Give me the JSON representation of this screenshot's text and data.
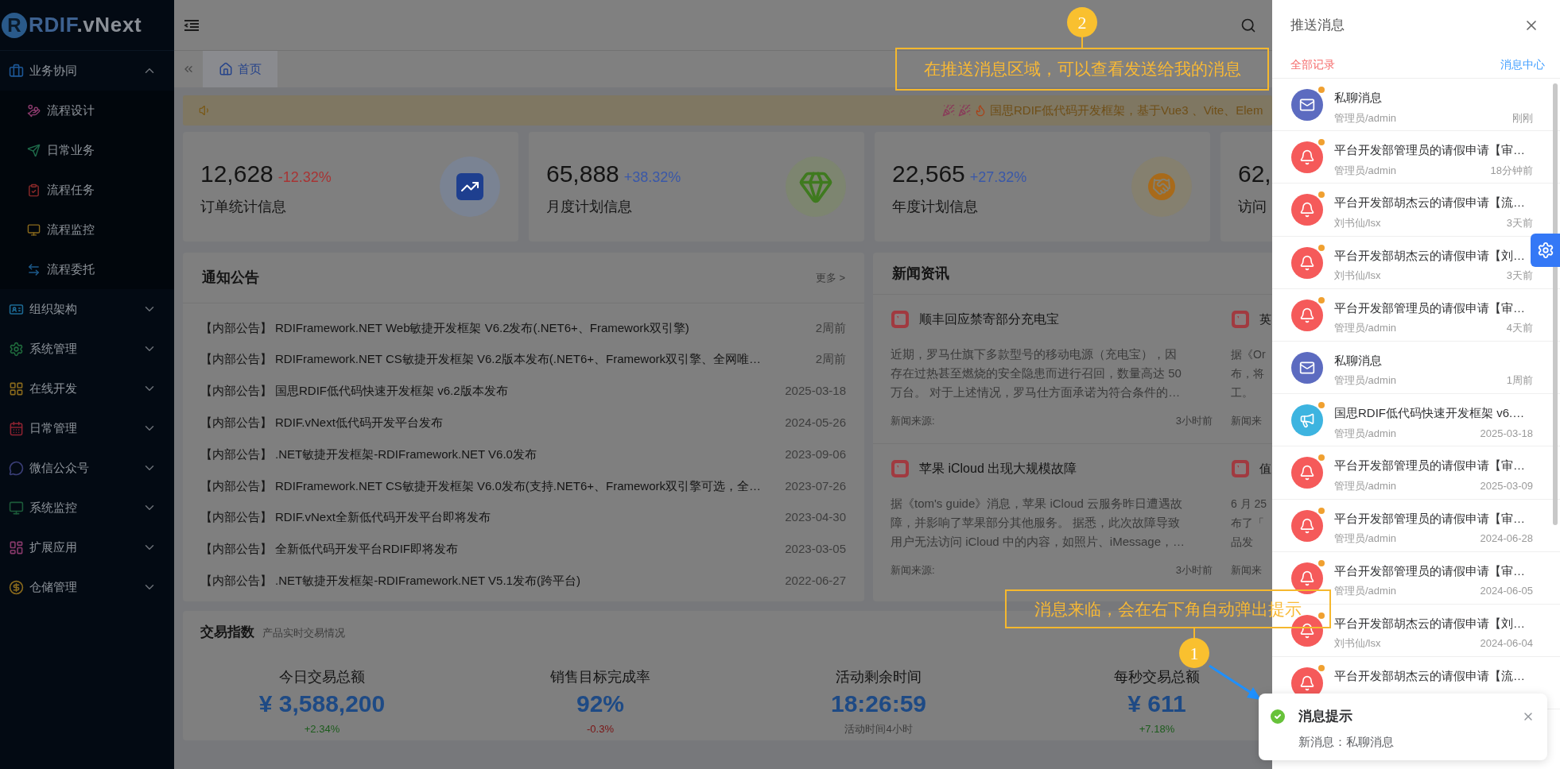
{
  "logo": {
    "mark": "R",
    "name": "RDIF",
    "suffix": ".vNext"
  },
  "sidebar": {
    "items": [
      {
        "label": "业务协同",
        "expanded": true,
        "children": [
          {
            "label": "流程设计"
          },
          {
            "label": "日常业务"
          },
          {
            "label": "流程任务"
          },
          {
            "label": "流程监控"
          },
          {
            "label": "流程委托"
          }
        ]
      },
      {
        "label": "组织架构",
        "expanded": false
      },
      {
        "label": "系统管理",
        "expanded": false
      },
      {
        "label": "在线开发",
        "expanded": false
      },
      {
        "label": "日常管理",
        "expanded": false
      },
      {
        "label": "微信公众号",
        "expanded": false
      },
      {
        "label": "系统监控",
        "expanded": false
      },
      {
        "label": "扩展应用",
        "expanded": false
      },
      {
        "label": "仓储管理",
        "expanded": false
      }
    ]
  },
  "tabs": [
    {
      "label": "首页",
      "selected": true
    }
  ],
  "announcement": {
    "text": "国思RDIF低代码开发框架，基于Vue3 、Vite、Elem"
  },
  "stats": [
    {
      "value": "12,628",
      "change": "-12.32%",
      "color": "#a83434",
      "label": "订单统计信息"
    },
    {
      "value": "65,888",
      "change": "+38.32%",
      "color": "#3a58a8",
      "label": "月度计划信息"
    },
    {
      "value": "22,565",
      "change": "+27.32%",
      "color": "#3a58a8",
      "label": "年度计划信息"
    },
    {
      "value": "62,",
      "label": "访问"
    }
  ],
  "notices": {
    "title": "通知公告",
    "more": "更多 >",
    "rows": [
      {
        "tag": "【内部公告】",
        "title": "RDIFramework.NET Web敏捷开发框架 V6.2发布(.NET6+、Framework双引擎)",
        "time": "2周前"
      },
      {
        "tag": "【内部公告】",
        "title": "RDIFramework.NET CS敏捷开发框架 V6.2版本发布(.NET6+、Framework双引擎、全网唯…",
        "time": "2周前"
      },
      {
        "tag": "【内部公告】",
        "title": "国思RDIF低代码快速开发框架 v6.2版本发布",
        "time": "2025-03-18"
      },
      {
        "tag": "【内部公告】",
        "title": "RDIF.vNext低代码开发平台发布",
        "time": "2024-05-26"
      },
      {
        "tag": "【内部公告】",
        "title": ".NET敏捷开发框架-RDIFramework.NET V6.0发布",
        "time": "2023-09-06"
      },
      {
        "tag": "【内部公告】",
        "title": "RDIFramework.NET CS敏捷开发框架 V6.0发布(支持.NET6+、Framework双引擎可选，全…",
        "time": "2023-07-26"
      },
      {
        "tag": "【内部公告】",
        "title": "RDIF.vNext全新低代码开发平台即将发布",
        "time": "2023-04-30"
      },
      {
        "tag": "【内部公告】",
        "title": "全新低代码开发平台RDIF即将发布",
        "time": "2023-03-05"
      },
      {
        "tag": "【内部公告】",
        "title": ".NET敏捷开发框架-RDIFramework.NET V5.1发布(跨平台)",
        "time": "2022-06-27"
      }
    ]
  },
  "news": {
    "title": "新闻资讯",
    "items": [
      {
        "title": "顺丰回应禁寄部分充电宝",
        "lines": [
          "近期，罗马仕旗下多款型号的移动电源（充电宝），因",
          "存在过热甚至燃烧的安全隐患而进行召回，数量高达 50",
          "万台。 对于上述情况，罗马仕方面承诺为符合条件的…"
        ],
        "source": "新闻来源:",
        "time": "3小时前"
      },
      {
        "title": "英",
        "lines": [
          "据《Or",
          "布，将",
          "工。"
        ],
        "source": "新闻来"
      },
      {
        "title": "苹果 iCloud 出现大规模故障",
        "lines": [
          "据《tom's guide》消息，苹果 iCloud 云服务昨日遭遇故",
          "障，并影响了苹果部分其他服务。 据悉，此次故障导致",
          "用户无法访问 iCloud 中的内容，如照片、iMessage，…"
        ],
        "source": "新闻来源:",
        "time": "3小时前"
      },
      {
        "title": "值",
        "lines": [
          "6 月 25",
          "布了「",
          "品发"
        ],
        "source": "新闻来"
      }
    ]
  },
  "trade": {
    "title": "交易指数",
    "subtitle": "产品实时交易情况",
    "items": [
      {
        "label": "今日交易总额",
        "value": "¥ 3,588,200",
        "change": "+2.34%",
        "color": "#1d5c1d"
      },
      {
        "label": "销售目标完成率",
        "value": "92%",
        "change": "-0.3%",
        "color": "#7a1414"
      },
      {
        "label": "活动剩余时间",
        "value": "18:26:59",
        "change": "活动时间4小时",
        "color": "#3c3c3c"
      },
      {
        "label": "每秒交易总额",
        "value": "¥ 611",
        "change": "+7.18%",
        "color": "#1d5c1d"
      }
    ]
  },
  "drawer": {
    "title": "推送消息",
    "tabs": [
      {
        "label": "全部记录",
        "selected": true
      },
      {
        "label": "消息中心",
        "selected": false
      }
    ],
    "messages": [
      {
        "kind": "mail",
        "title": "私聊消息",
        "sender": "管理员/admin",
        "time": "刚刚",
        "unread": true
      },
      {
        "kind": "bell",
        "title": "平台开发部管理员的请假申请【审…",
        "sender": "管理员/admin",
        "time": "18分钟前",
        "unread": true
      },
      {
        "kind": "bell",
        "title": "平台开发部胡杰云的请假申请【流…",
        "sender": "刘书仙/lsx",
        "time": "3天前",
        "unread": true
      },
      {
        "kind": "bell",
        "title": "平台开发部胡杰云的请假申请【刘…",
        "sender": "刘书仙/lsx",
        "time": "3天前",
        "unread": true
      },
      {
        "kind": "bell",
        "title": "平台开发部管理员的请假申请【审…",
        "sender": "管理员/admin",
        "time": "4天前",
        "unread": true
      },
      {
        "kind": "mail",
        "title": "私聊消息",
        "sender": "管理员/admin",
        "time": "1周前",
        "unread": false
      },
      {
        "kind": "notice",
        "title": "国思RDIF低代码快速开发框架 v6.…",
        "sender": "管理员/admin",
        "time": "2025-03-18",
        "unread": true
      },
      {
        "kind": "bell",
        "title": "平台开发部管理员的请假申请【审…",
        "sender": "管理员/admin",
        "time": "2025-03-09",
        "unread": true
      },
      {
        "kind": "bell",
        "title": "平台开发部管理员的请假申请【审…",
        "sender": "管理员/admin",
        "time": "2024-06-28",
        "unread": true
      },
      {
        "kind": "bell",
        "title": "平台开发部管理员的请假申请【审…",
        "sender": "管理员/admin",
        "time": "2024-06-05",
        "unread": true
      },
      {
        "kind": "bell",
        "title": "平台开发部胡杰云的请假申请【刘…",
        "sender": "刘书仙/lsx",
        "time": "2024-06-04",
        "unread": true
      },
      {
        "kind": "bell",
        "title": "平台开发部胡杰云的请假申请【流…",
        "unread": true
      }
    ]
  },
  "toast": {
    "title": "消息提示",
    "message": "新消息：私聊消息"
  },
  "annotations": [
    {
      "number": "1",
      "text": "消息来临，会在右下角自动弹出提示"
    },
    {
      "number": "2",
      "text": "在推送消息区域，可以查看发送给我的消息"
    }
  ]
}
